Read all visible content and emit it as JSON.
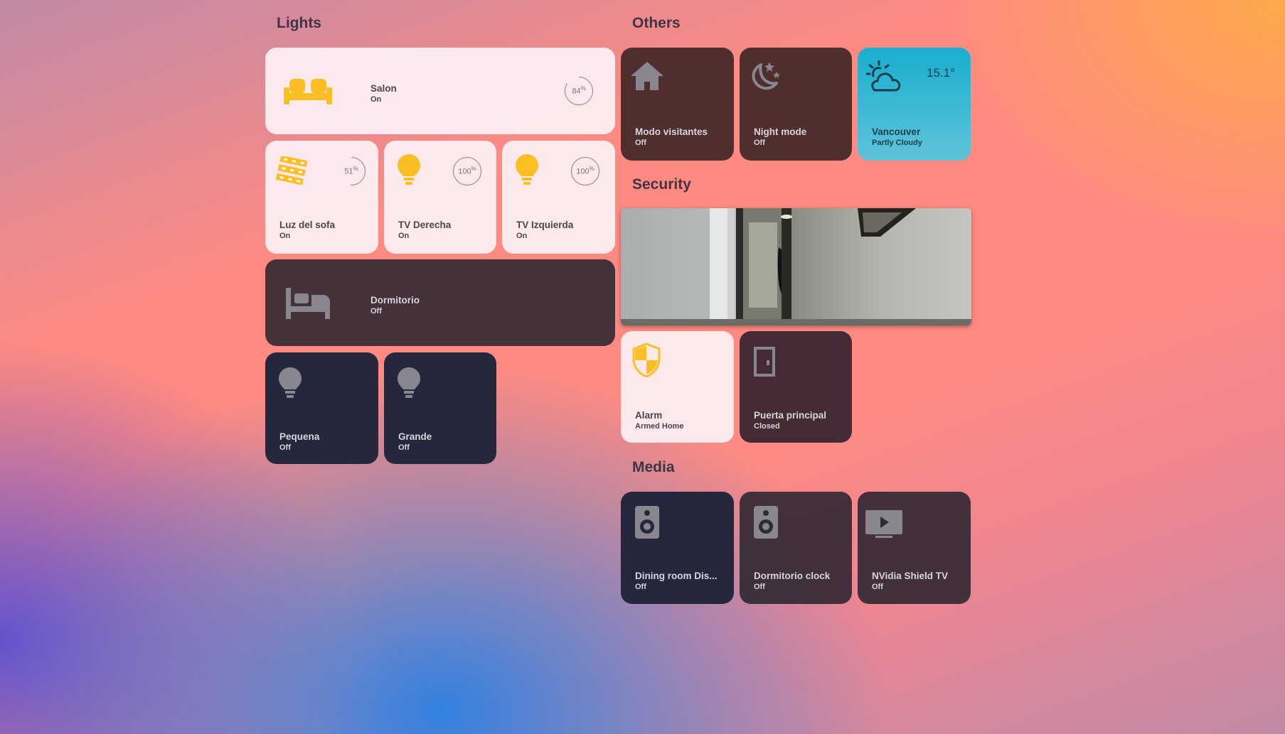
{
  "sections": {
    "lights": "Lights",
    "others": "Others",
    "security": "Security",
    "media": "Media"
  },
  "lights": {
    "salon": {
      "name": "Salon",
      "state": "On",
      "brightness": "84",
      "unit": "%"
    },
    "luz_sofa": {
      "name": "Luz del sofa",
      "state": "On",
      "brightness": "51",
      "unit": "%"
    },
    "tv_derecha": {
      "name": "TV Derecha",
      "state": "On",
      "brightness": "100",
      "unit": "%"
    },
    "tv_izquierda": {
      "name": "TV Izquierda",
      "state": "On",
      "brightness": "100",
      "unit": "%"
    },
    "dormitorio": {
      "name": "Dormitorio",
      "state": "Off"
    },
    "pequena": {
      "name": "Pequena",
      "state": "Off"
    },
    "grande": {
      "name": "Grande",
      "state": "Off"
    }
  },
  "others": {
    "modo_visitantes": {
      "name": "Modo visitantes",
      "state": "Off"
    },
    "night_mode": {
      "name": "Night mode",
      "state": "Off"
    },
    "weather": {
      "name": "Vancouver",
      "state": "Partly Cloudy",
      "temperature": "15.1°"
    }
  },
  "security": {
    "alarm": {
      "name": "Alarm",
      "state": "Armed Home"
    },
    "puerta": {
      "name": "Puerta principal",
      "state": "Closed"
    }
  },
  "media": {
    "dining": {
      "name": "Dining room Dis...",
      "state": "Off"
    },
    "dormitorio_clock": {
      "name": "Dormitorio clock",
      "state": "Off"
    },
    "shield": {
      "name": "NVidia Shield TV",
      "state": "Off"
    }
  },
  "colors": {
    "on_icon": "#fbbf24",
    "off_icon": "#8a8690",
    "title": "#3f3545"
  },
  "icons": [
    "sofa-icon",
    "led-strip-icon",
    "lightbulb-icon",
    "bed-icon",
    "home-icon",
    "night-icon",
    "weather-partly-cloudy-icon",
    "shield-icon",
    "door-icon",
    "speaker-icon",
    "tv-icon"
  ]
}
